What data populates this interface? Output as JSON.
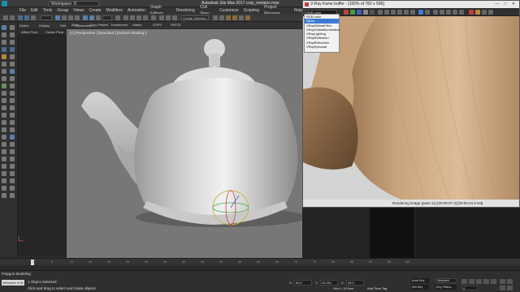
{
  "titlebar": {
    "workspace": "Workspace: D",
    "title": "Autodesk 3ds Max 2017     cray_metalex.max",
    "window_buttons": [
      "—",
      "□",
      "✕"
    ]
  },
  "menu": {
    "items": [
      "File",
      "Edit",
      "Tools",
      "Group",
      "Views",
      "Create",
      "Modifiers",
      "Animation",
      "Graph Editors",
      "Rendering",
      "Civil View",
      "Customize",
      "Scripting",
      "Project Manager",
      "Help"
    ]
  },
  "toolbar": {
    "create_selection_set": "Create Selection Se"
  },
  "ribbon": {
    "items": [
      "Select",
      "Display",
      "Edit",
      "Customize"
    ]
  },
  "explorer": {
    "headers": [
      "Affect Pivot",
      "Center Pivot",
      "Align"
    ],
    "extra": [
      "Copy Pasted",
      "Transformer",
      "Attach",
      "COPY",
      "PASTE"
    ]
  },
  "viewport": {
    "label": "[+] [Perspective ] [Standard ] [Default Shading ]"
  },
  "vfb": {
    "title": "V-Ray frame buffer - [100% of 782 x 586]",
    "channel": "RGB color",
    "dropdown": [
      "RGB color",
      "Alpha",
      "VRayDiffuseFilter",
      "VRayGlobalIllumination",
      "VRayLighting",
      "VRayReflection",
      "VRayRefraction",
      "VRaySpecular"
    ],
    "selected_index": 1,
    "status": "Rendering image (pass 11) [00:00:07.4] [00:00:43.3 est]"
  },
  "timeline": {
    "ticks": [
      "0",
      "5",
      "10",
      "15",
      "20",
      "25",
      "30",
      "35",
      "40",
      "45",
      "50",
      "55",
      "60",
      "65",
      "70",
      "75",
      "80",
      "85",
      "90",
      "95",
      "100"
    ]
  },
  "status": {
    "mode": "Polygon Modeling",
    "welcome": "Welcome to M",
    "selected": "1 Object Selected",
    "hint": "Click and drag to select and rotate objects",
    "x_label": "X:",
    "x_value": "30.0",
    "y_label": "Y:",
    "y_value": "26.251",
    "z_label": "Z:",
    "z_value": "35.0",
    "grid": "Grid = 10.0cm",
    "add_time_tag": "Add Time Tag",
    "auto_key": "Auto Key",
    "set_key": "Set Key",
    "selected_set": "Selected",
    "key_filters": "Key Filters...",
    "frame": "0"
  },
  "colors": {
    "accent": "#1a8fa8",
    "selection_blue": "#3b7bd4",
    "wood": "#caa57e"
  }
}
